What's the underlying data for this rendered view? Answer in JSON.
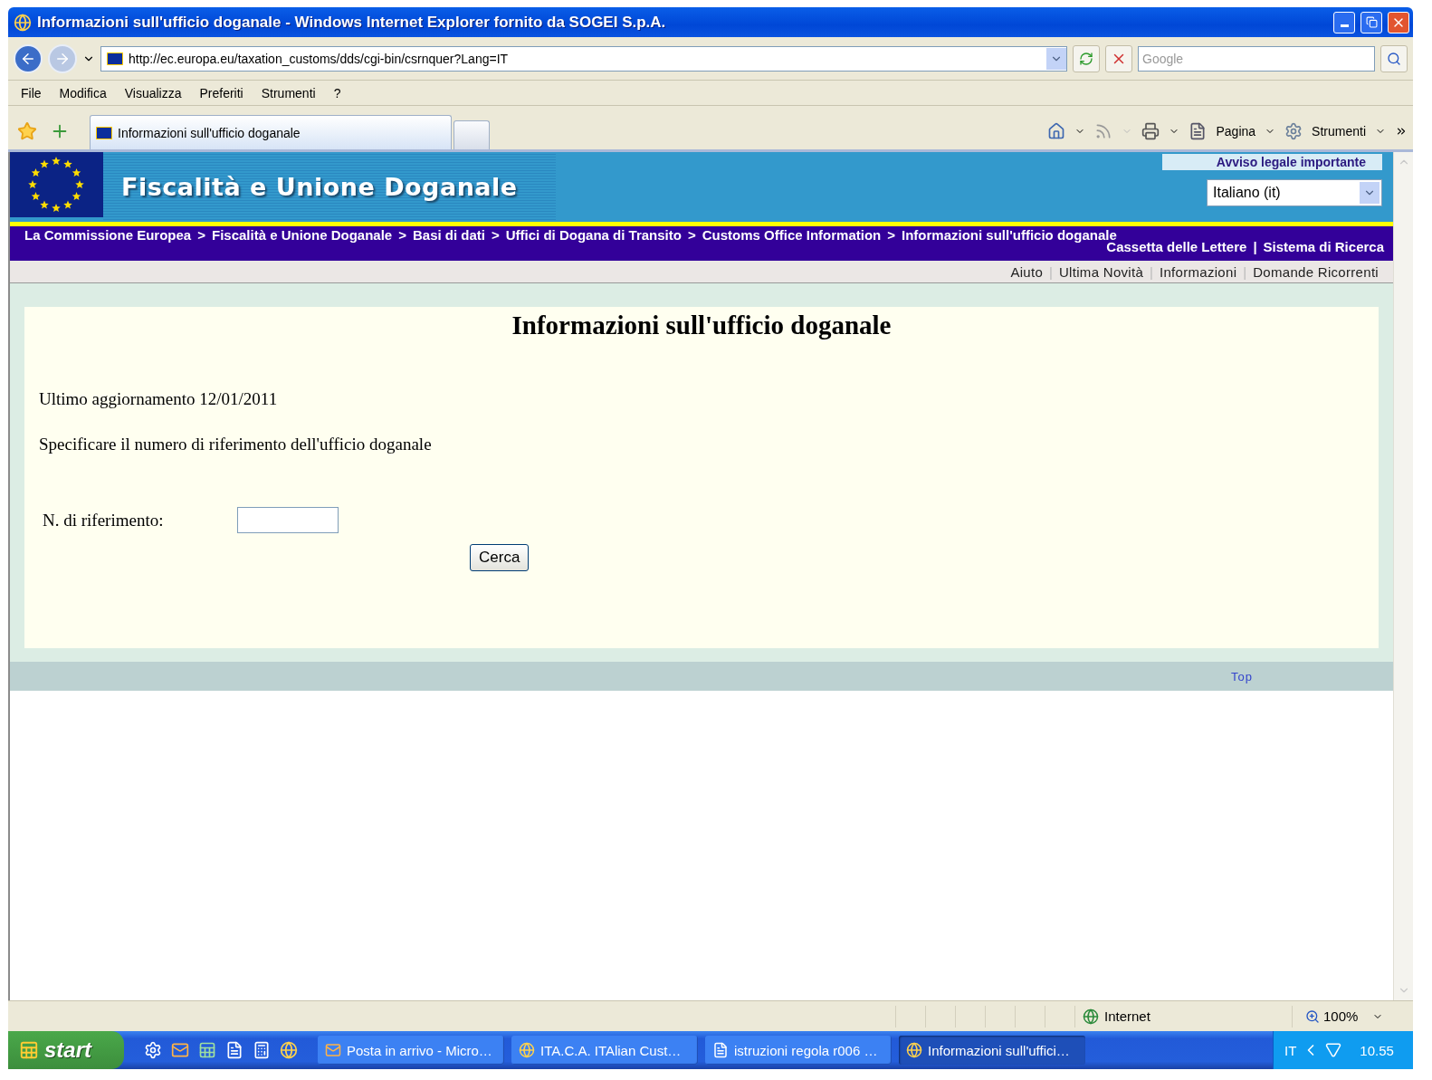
{
  "window": {
    "title": "Informazioni sull'ufficio doganale - Windows Internet Explorer fornito da SOGEI S.p.A."
  },
  "address_bar": {
    "url": "http://ec.europa.eu/taxation_customs/dds/cgi-bin/csrnquer?Lang=IT",
    "search_placeholder": "Google"
  },
  "menu": [
    "File",
    "Modifica",
    "Visualizza",
    "Preferiti",
    "Strumenti",
    "?"
  ],
  "tab": {
    "title": "Informazioni sull'ufficio doganale"
  },
  "command_bar": [
    "Pagina",
    "Strumenti"
  ],
  "site": {
    "title": "Fiscalità e Unione Doganale",
    "legal_notice": "Avviso legale importante",
    "language": "Italiano (it)",
    "breadcrumb": {
      "separator": ">",
      "items": [
        "La Commissione Europea",
        "Fiscalità e Unione Doganale",
        "Basi di dati",
        "Uffici di Dogana di Transito",
        "Customs Office Information",
        "Informazioni sull'ufficio doganale"
      ]
    },
    "top_links": {
      "separator": "|",
      "items": [
        "Cassetta delle Lettere",
        "Sistema di Ricerca"
      ]
    },
    "nav_links": {
      "separator": "|",
      "items": [
        "Aiuto",
        "Ultima Novità",
        "Informazioni",
        "Domande Ricorrenti"
      ]
    },
    "heading": "Informazioni sull'ufficio doganale",
    "updated": "Ultimo aggiornamento 12/01/2011",
    "instruction": "Specificare il numero di riferimento dell'ufficio doganale",
    "field_label": "N. di riferimento:",
    "button": "Cerca",
    "top_link": "Top"
  },
  "status_bar": {
    "zone": "Internet",
    "zoom": "100%"
  },
  "taskbar": {
    "start": "start",
    "tasks": [
      {
        "label": "Posta in arrivo - Micro…",
        "kind": "mail",
        "selected": false
      },
      {
        "label": "ITA.C.A. ITAlian Cust…",
        "kind": "browser",
        "selected": false
      },
      {
        "label": "istruzioni regola r006 …",
        "kind": "document",
        "selected": false
      },
      {
        "label": "Informazioni sull'uffici…",
        "kind": "browser",
        "selected": true
      }
    ],
    "language": "IT",
    "clock": "10.55"
  }
}
